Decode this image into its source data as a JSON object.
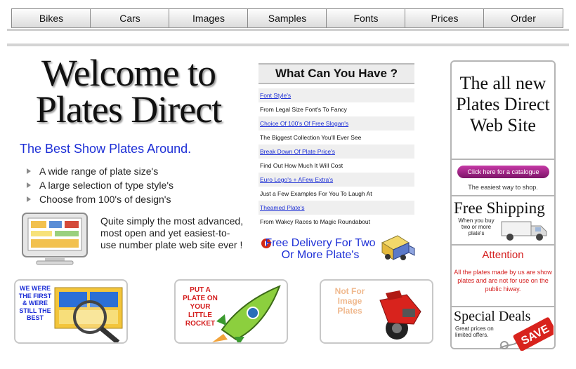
{
  "nav": {
    "tabs": [
      "Bikes",
      "Cars",
      "Images",
      "Samples",
      "Fonts",
      "Prices",
      "Order"
    ]
  },
  "welcome": {
    "heading_line1": "Welcome to",
    "heading_line2": "Plates Direct",
    "tagline": "The Best Show Plates Around.",
    "bullets": [
      "A wide range of plate size's",
      "A large selection of type style's",
      "Choose from 100's of design's"
    ],
    "quote": "Quite simply the most advanced, most open and yet easiest-to-use number plate web site ever !"
  },
  "what_can_you_have": {
    "title": "What Can You Have ?",
    "rows": [
      {
        "kind": "link",
        "text": "Font Style's"
      },
      {
        "kind": "text",
        "text": "From Legal Size Font's To Fancy"
      },
      {
        "kind": "link",
        "text": "Choice Of 100's Of Free Slogan's"
      },
      {
        "kind": "text",
        "text": "The Biggest Collection You'll Ever See"
      },
      {
        "kind": "link",
        "text": "Break Down Of Plate Price's"
      },
      {
        "kind": "text",
        "text": "Find Out How Much It Will Cost"
      },
      {
        "kind": "link",
        "text": "Euro Logo's + AFew Extra's"
      },
      {
        "kind": "text",
        "text": "Just a Few Examples For You To Laugh At"
      },
      {
        "kind": "link",
        "text": "Theamed Plate's"
      },
      {
        "kind": "text",
        "text": "From Wakcy Races to Magic Roundabout"
      }
    ],
    "free_delivery": "Free Delivery For Two Or More Plate's"
  },
  "sidebar": {
    "headline_line1": "The all new",
    "headline_line2": "Plates Direct",
    "headline_line3": "Web Site",
    "catalogue_button": "Click here for a catalogue",
    "catalogue_sub": "The easiest way to shop.",
    "shipping_title": "Free Shipping",
    "shipping_sub": "When you buy two or more plate's",
    "attention_title": "Attention",
    "attention_body": "All the plates made by us are show plates and are not for use on the public hiway.",
    "deals_title": "Special Deals",
    "deals_sub": "Great prices on limited offers.",
    "save_stamp": "SAVE"
  },
  "promos": [
    {
      "text": "WE WERE THE FIRST & WERE STILL THE BEST"
    },
    {
      "text": "PUT A PLATE ON YOUR LITTLE ROCKET"
    },
    {
      "text": "Not For Image Plates"
    }
  ],
  "colors": {
    "link_blue": "#1d2fd6",
    "attention_red": "#d41d1d",
    "catalogue_purple": "#a0288a",
    "border_grey": "#b5b5b5"
  }
}
